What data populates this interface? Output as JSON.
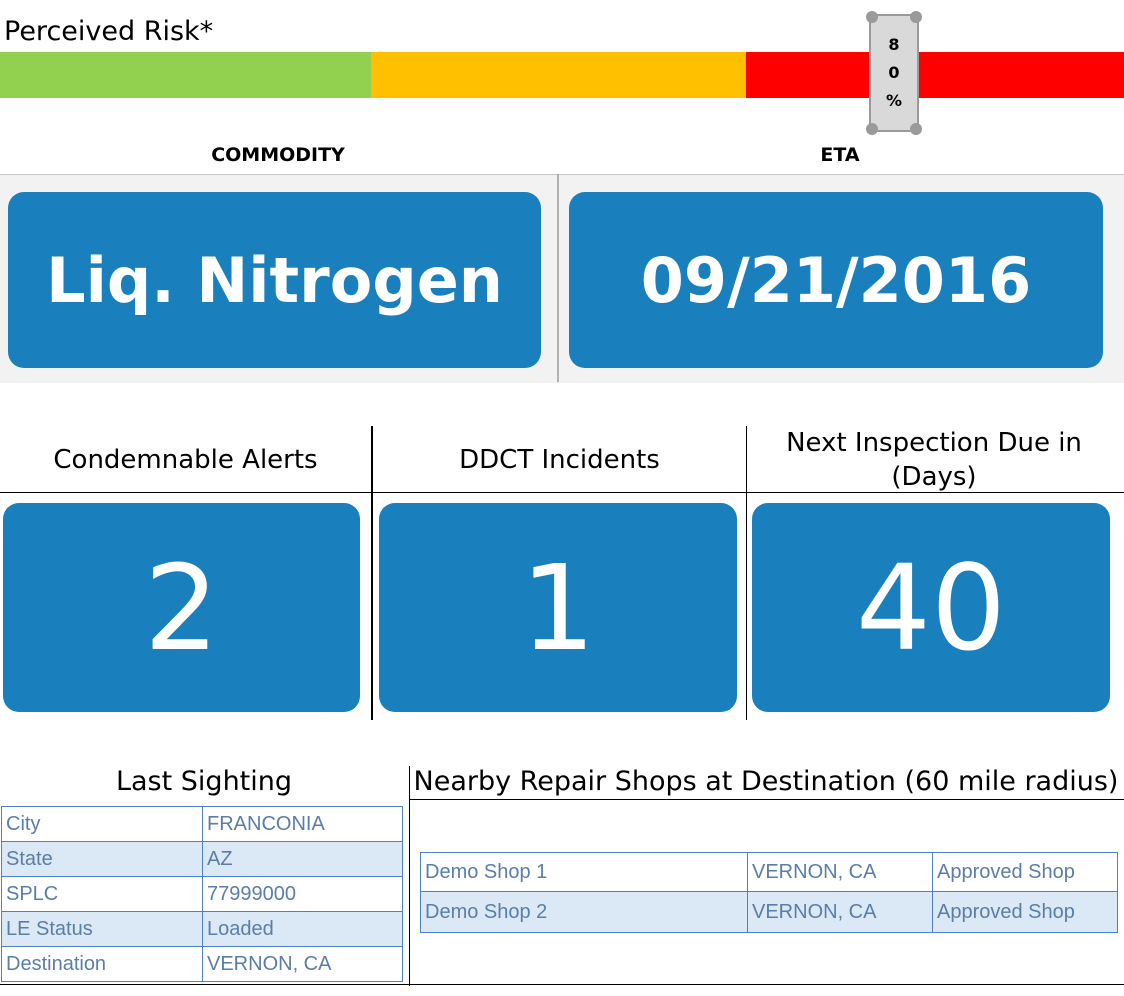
{
  "risk": {
    "title": "Perceived Risk*",
    "value_percent": 80,
    "indicator_chars": [
      "8",
      "0",
      "%"
    ],
    "colors": [
      "#92d050",
      "#ffc000",
      "#ff0000"
    ]
  },
  "commodity": {
    "label": "COMMODITY",
    "value": "Liq. Nitrogen"
  },
  "eta": {
    "label": "ETA",
    "value": "09/21/2016"
  },
  "metrics": [
    {
      "label": "Condemnable Alerts",
      "value": "2"
    },
    {
      "label": "DDCT Incidents",
      "value": "1"
    },
    {
      "label": "Next Inspection Due in (Days)",
      "value": "40"
    }
  ],
  "last_sighting": {
    "title": "Last Sighting",
    "rows": [
      {
        "key": "City",
        "value": "FRANCONIA"
      },
      {
        "key": "State",
        "value": "AZ"
      },
      {
        "key": "SPLC",
        "value": "77999000"
      },
      {
        "key": "LE Status",
        "value": "Loaded"
      },
      {
        "key": "Destination",
        "value": "VERNON, CA"
      }
    ]
  },
  "repair_shops": {
    "title": "Nearby Repair Shops at Destination (60 mile radius)",
    "rows": [
      {
        "name": "Demo Shop 1",
        "location": "VERNON, CA",
        "status": "Approved Shop"
      },
      {
        "name": "Demo Shop 2",
        "location": "VERNON, CA",
        "status": "Approved Shop"
      }
    ]
  },
  "tile_color": "#1a80bd"
}
